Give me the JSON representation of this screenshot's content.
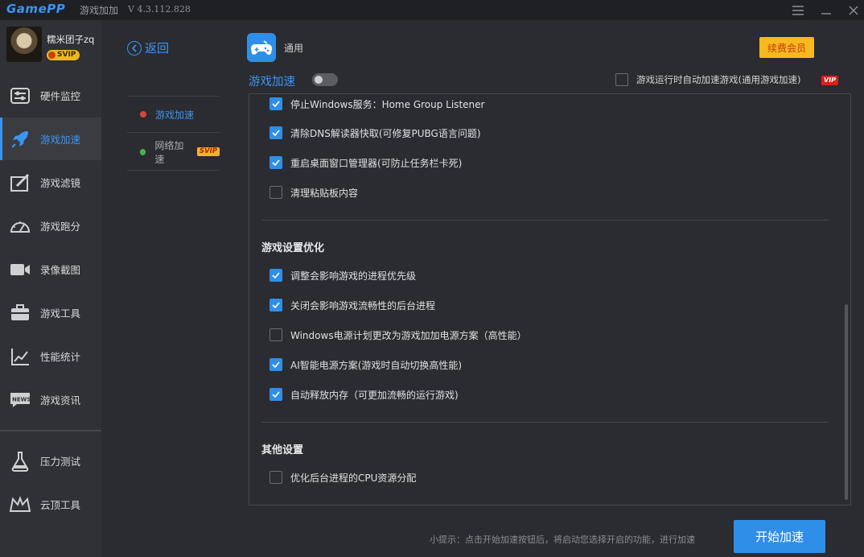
{
  "titlebar": {
    "logo": "GamePP",
    "title": "游戏加加",
    "version": "V 4.3.112.828"
  },
  "profile": {
    "username": "糯米团子zq",
    "badge": "SVIP"
  },
  "sidebar": {
    "items": [
      {
        "label": "硬件监控",
        "icon": "hardware-monitor-icon"
      },
      {
        "label": "游戏加速",
        "icon": "rocket-icon",
        "active": true
      },
      {
        "label": "游戏滤镜",
        "icon": "filter-icon"
      },
      {
        "label": "游戏跑分",
        "icon": "speedometer-icon"
      },
      {
        "label": "录像截图",
        "icon": "camera-icon"
      },
      {
        "label": "游戏工具",
        "icon": "toolbox-icon"
      },
      {
        "label": "性能统计",
        "icon": "chart-icon"
      },
      {
        "label": "游戏资讯",
        "icon": "news-icon"
      },
      {
        "label": "压力测试",
        "icon": "flask-icon"
      },
      {
        "label": "云顶工具",
        "icon": "crown-icon"
      }
    ]
  },
  "back_label": "返回",
  "subnav": [
    {
      "label": "游戏加速",
      "dot_color": "#d8453b",
      "active": true
    },
    {
      "label": "网络加速",
      "dot_color": "#47b449",
      "tag": "SVIP"
    }
  ],
  "header": {
    "app_label": "通用",
    "renew_button": "续费会员",
    "section_title": "游戏加速",
    "auto_accelerate_label": "游戏运行时自动加速游戏(通用游戏加速)",
    "vip_tag": "VIP"
  },
  "options_top": [
    {
      "label": "停止Windows服务：Home Group Listener",
      "checked": true
    },
    {
      "label": "清除DNS解读器快取(可修复PUBG语言问题)",
      "checked": true
    },
    {
      "label": "重启桌面窗口管理器(可防止任务栏卡死)",
      "checked": true
    },
    {
      "label": "清理粘贴板内容",
      "checked": false
    }
  ],
  "game_settings": {
    "title": "游戏设置优化",
    "options": [
      {
        "label": "调整会影响游戏的进程优先级",
        "checked": true
      },
      {
        "label": "关闭会影响游戏流畅性的后台进程",
        "checked": true
      },
      {
        "label": "Windows电源计划更改为游戏加加电源方案（高性能）",
        "checked": false
      },
      {
        "label": "AI智能电源方案(游戏时自动切换高性能)",
        "checked": true
      },
      {
        "label": "自动释放内存（可更加流畅的运行游戏)",
        "checked": true
      }
    ]
  },
  "other_settings": {
    "title": "其他设置",
    "options": [
      {
        "label": "优化后台进程的CPU资源分配",
        "checked": false
      }
    ]
  },
  "footer": {
    "hint": "小提示：点击开始加速按钮后，将启动您选择开启的功能，进行加速",
    "start_button": "开始加速"
  }
}
